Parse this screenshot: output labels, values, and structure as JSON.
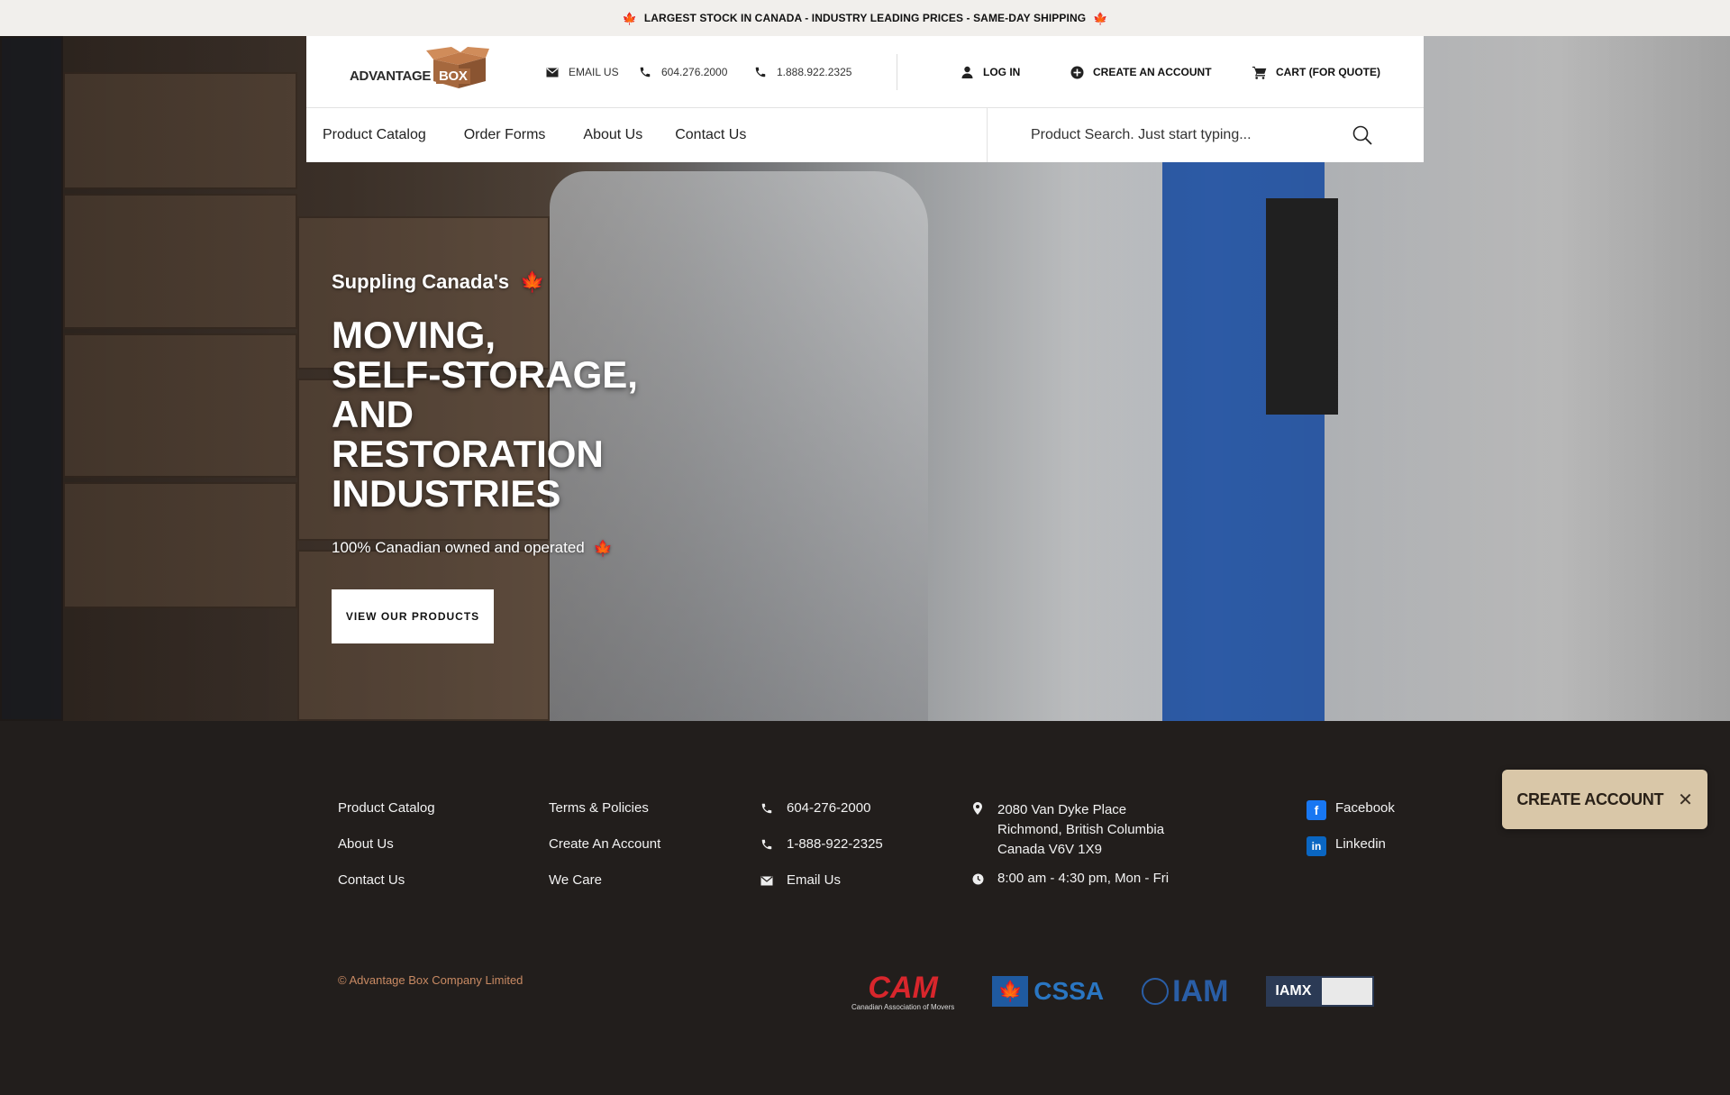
{
  "topbar": {
    "message": "LARGEST STOCK IN CANADA - INDUSTRY LEADING PRICES - SAME-DAY SHIPPING"
  },
  "header": {
    "logo": {
      "left": "ADVANTAGE",
      "right": "BOX"
    },
    "email_label": "EMAIL US",
    "phone1": "604.276.2000",
    "phone2": "1.888.922.2325",
    "login_label": "LOG IN",
    "create_account_label": "CREATE AN ACCOUNT",
    "cart_label": "CART (FOR QUOTE)"
  },
  "nav": {
    "items": [
      {
        "label": "Product Catalog"
      },
      {
        "label": "Order Forms"
      },
      {
        "label": "About Us"
      },
      {
        "label": "Contact Us"
      }
    ]
  },
  "search": {
    "placeholder": "Product Search. Just start typing..."
  },
  "hero": {
    "kicker": "Suppling Canada's",
    "title_lines": [
      "MOVING,",
      "SELF-STORAGE,",
      "AND RESTORATION",
      "INDUSTRIES"
    ],
    "subtitle": "100% Canadian owned and operated",
    "button_label": "VIEW OUR PRODUCTS"
  },
  "footer": {
    "col1": [
      {
        "label": "Product Catalog"
      },
      {
        "label": "About Us"
      },
      {
        "label": "Contact Us"
      }
    ],
    "col2": [
      {
        "label": "Terms & Policies"
      },
      {
        "label": "Create An Account"
      },
      {
        "label": "We Care"
      }
    ],
    "contact": {
      "phone1": "604-276-2000",
      "phone2": "1-888-922-2325",
      "email": "Email Us"
    },
    "address": {
      "line1": "2080 Van Dyke Place",
      "line2": "Richmond, British Columbia",
      "line3": "Canada V6V 1X9",
      "hours": "8:00 am - 4:30 pm, Mon - Fri"
    },
    "social": [
      {
        "label": "Facebook",
        "icon": "facebook-icon",
        "color": "#1877f2"
      },
      {
        "label": "Linkedin",
        "icon": "linkedin-icon",
        "color": "#0a66c2"
      }
    ],
    "copyright": "© Advantage Box Company Limited",
    "badges": [
      {
        "name": "CAM",
        "caption": "Canadian Association of Movers"
      },
      {
        "name": "CSSA"
      },
      {
        "name": "IAM"
      },
      {
        "name": "IAMX"
      }
    ]
  },
  "popup": {
    "label": "CREATE ACCOUNT"
  },
  "colors": {
    "topbar_bg": "#f1efec",
    "footer_bg": "#221e1c",
    "maple_red": "#d32222",
    "popup_bg": "#d9c7a8",
    "copyright": "#c98a63",
    "logo_brown": "#a5683e"
  }
}
